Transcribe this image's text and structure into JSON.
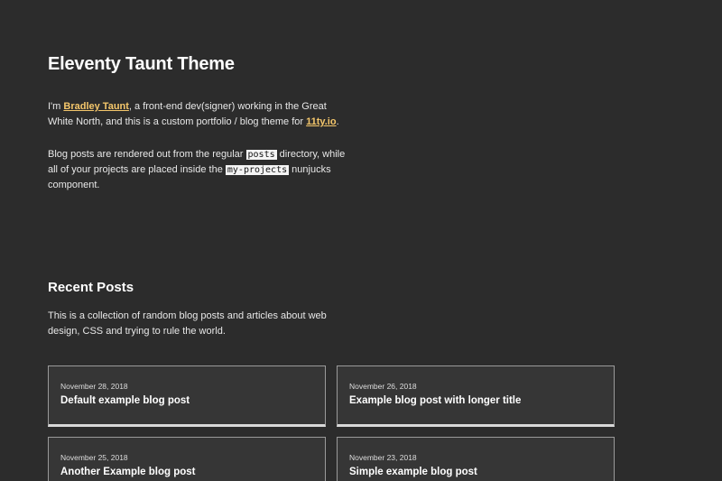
{
  "header": {
    "title": "Eleventy Taunt Theme"
  },
  "intro": {
    "p1_before": "I'm ",
    "author_link": "Bradley Taunt",
    "p1_middle": ", a front-end dev(signer) working in the Great White North, and this is a custom portfolio / blog theme for ",
    "site_link": "11ty.io",
    "p1_end": ".",
    "p2_before": "Blog posts are rendered out from the regular ",
    "p2_code1": "posts",
    "p2_middle": " directory, while all of your projects are placed inside the ",
    "p2_code2": "my-projects",
    "p2_end": " nunjucks component."
  },
  "recent_posts": {
    "title": "Recent Posts",
    "description": "This is a collection of random blog posts and articles about web design, CSS and trying to rule the world.",
    "posts": [
      {
        "date": "November 28, 2018",
        "title": "Default example blog post"
      },
      {
        "date": "November 26, 2018",
        "title": "Example blog post with longer title"
      },
      {
        "date": "November 25, 2018",
        "title": "Another Example blog post"
      },
      {
        "date": "November 23, 2018",
        "title": "Simple example blog post"
      }
    ]
  },
  "colors": {
    "background": "#2c2c2c",
    "link_accent": "#f5c76b",
    "card_background": "#363636"
  }
}
